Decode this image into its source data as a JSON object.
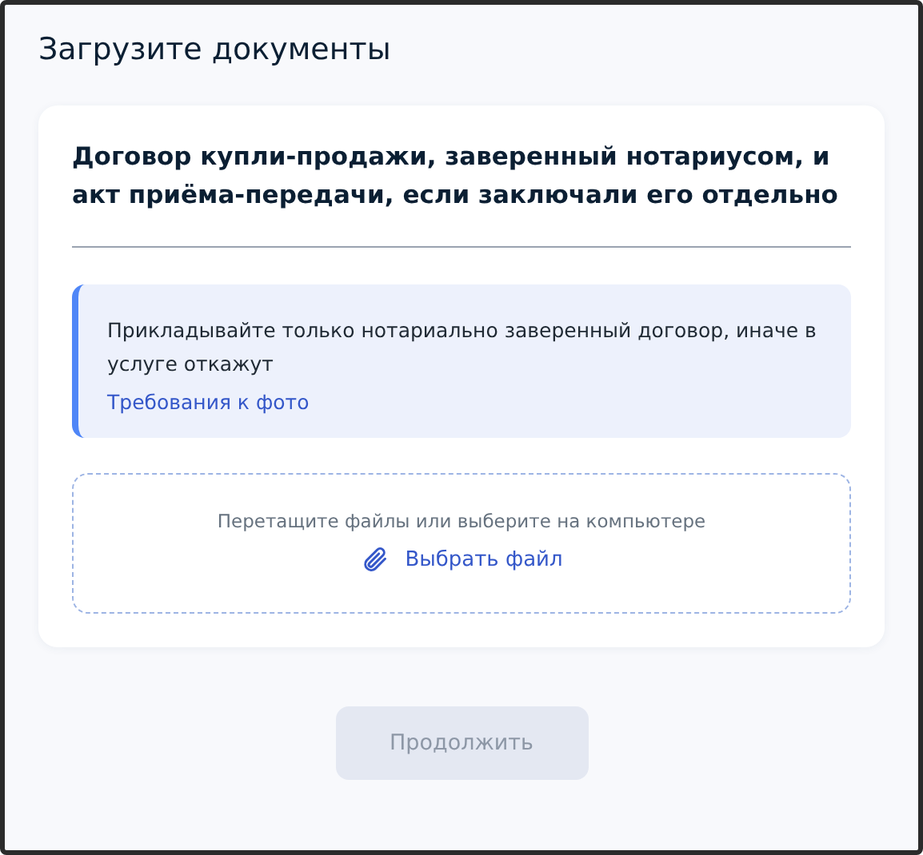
{
  "page": {
    "title": "Загрузите документы"
  },
  "document": {
    "title": "Договор купли-продажи, заверенный нотариусом, и акт приёма-передачи, если заключали его отдельно",
    "notice": {
      "text": "Прикладывайте только нотариально заверенный договор, иначе в услуге откажут",
      "link": "Требования к фото"
    },
    "dropzone": {
      "hint": "Перетащите файлы или выберите на компьютере",
      "action": "Выбрать файл"
    }
  },
  "continue_button": {
    "label": "Продолжить",
    "disabled": true
  }
}
